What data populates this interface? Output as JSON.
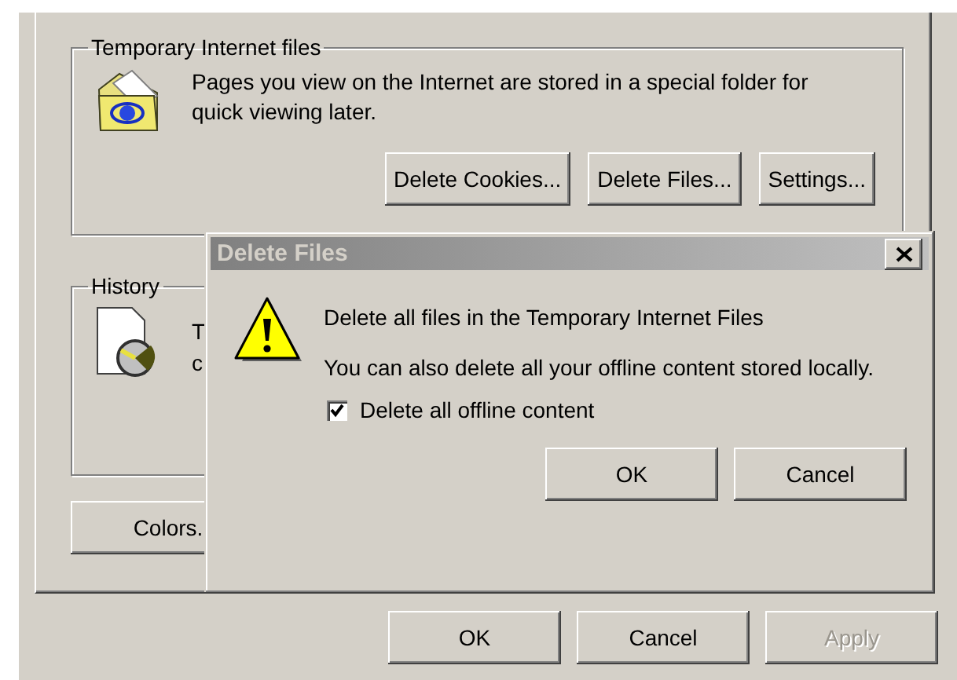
{
  "temporary_files": {
    "title": "Temporary Internet files",
    "description": "Pages you view on the Internet are stored in a special folder for quick viewing later.",
    "buttons": [
      {
        "label": "Delete Cookies...",
        "disabled": false
      },
      {
        "label": "Delete Files...",
        "disabled": false
      },
      {
        "label": "Settings...",
        "disabled": false
      }
    ]
  },
  "history": {
    "title": "History",
    "text_lines": [
      "T",
      "c"
    ]
  },
  "colors_button": {
    "label": "Colors.",
    "disabled": false
  },
  "dialog": {
    "title": "Delete Files",
    "message": "Delete all files in the Temporary Internet Files",
    "detail": "You can also delete all your offline content stored locally.",
    "checkbox": {
      "label": "Delete all offline content",
      "checked": true
    },
    "buttons": [
      {
        "label": "OK",
        "disabled": false
      },
      {
        "label": "Cancel",
        "disabled": false
      }
    ]
  },
  "buttons": [
    {
      "label": "OK",
      "disabled": false
    },
    {
      "label": "Cancel",
      "disabled": false
    },
    {
      "label": "Apply",
      "disabled": true
    }
  ]
}
